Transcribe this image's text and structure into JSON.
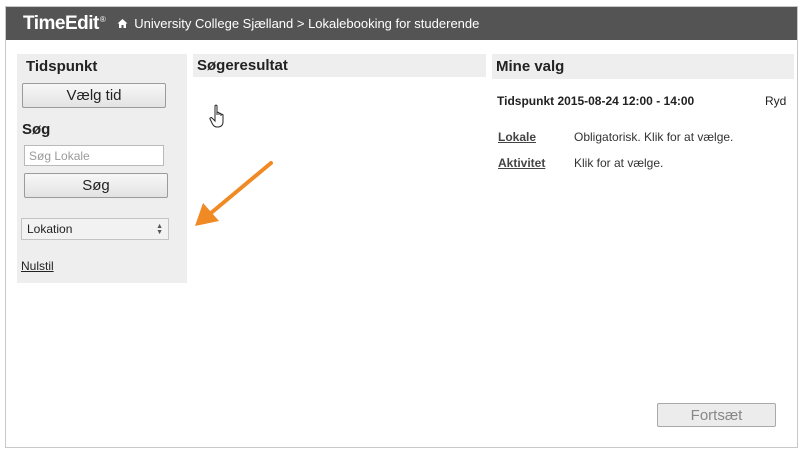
{
  "header": {
    "logo_text": "TimeEdit",
    "logo_mark": "®",
    "breadcrumb": "University College Sjælland > Lokalebooking for studerende",
    "bar_color": "#545454"
  },
  "left_panel": {
    "time_heading": "Tidspunkt",
    "choose_time_button": "Vælg tid",
    "search_heading": "Søg",
    "search_placeholder": "Søg Lokale",
    "search_button": "Søg",
    "location_select": "Lokation",
    "reset_link": "Nulstil"
  },
  "results": {
    "heading": "Søgeresultat"
  },
  "selections": {
    "heading": "Mine valg",
    "time_line": "Tidspunkt 2015-08-24 12:00 - 14:00",
    "clear_link": "Ryd",
    "rows": [
      {
        "label": "Lokale",
        "desc": "Obligatorisk. Klik for at vælge."
      },
      {
        "label": "Aktivitet",
        "desc": "Klik for at vælge."
      }
    ]
  },
  "footer": {
    "continue_button": "Fortsæt"
  },
  "annotation": {
    "arrow_color": "#f08a24",
    "arrow_icon": "arrow-annotation-icon",
    "cursor_icon": "hand-cursor-icon"
  }
}
